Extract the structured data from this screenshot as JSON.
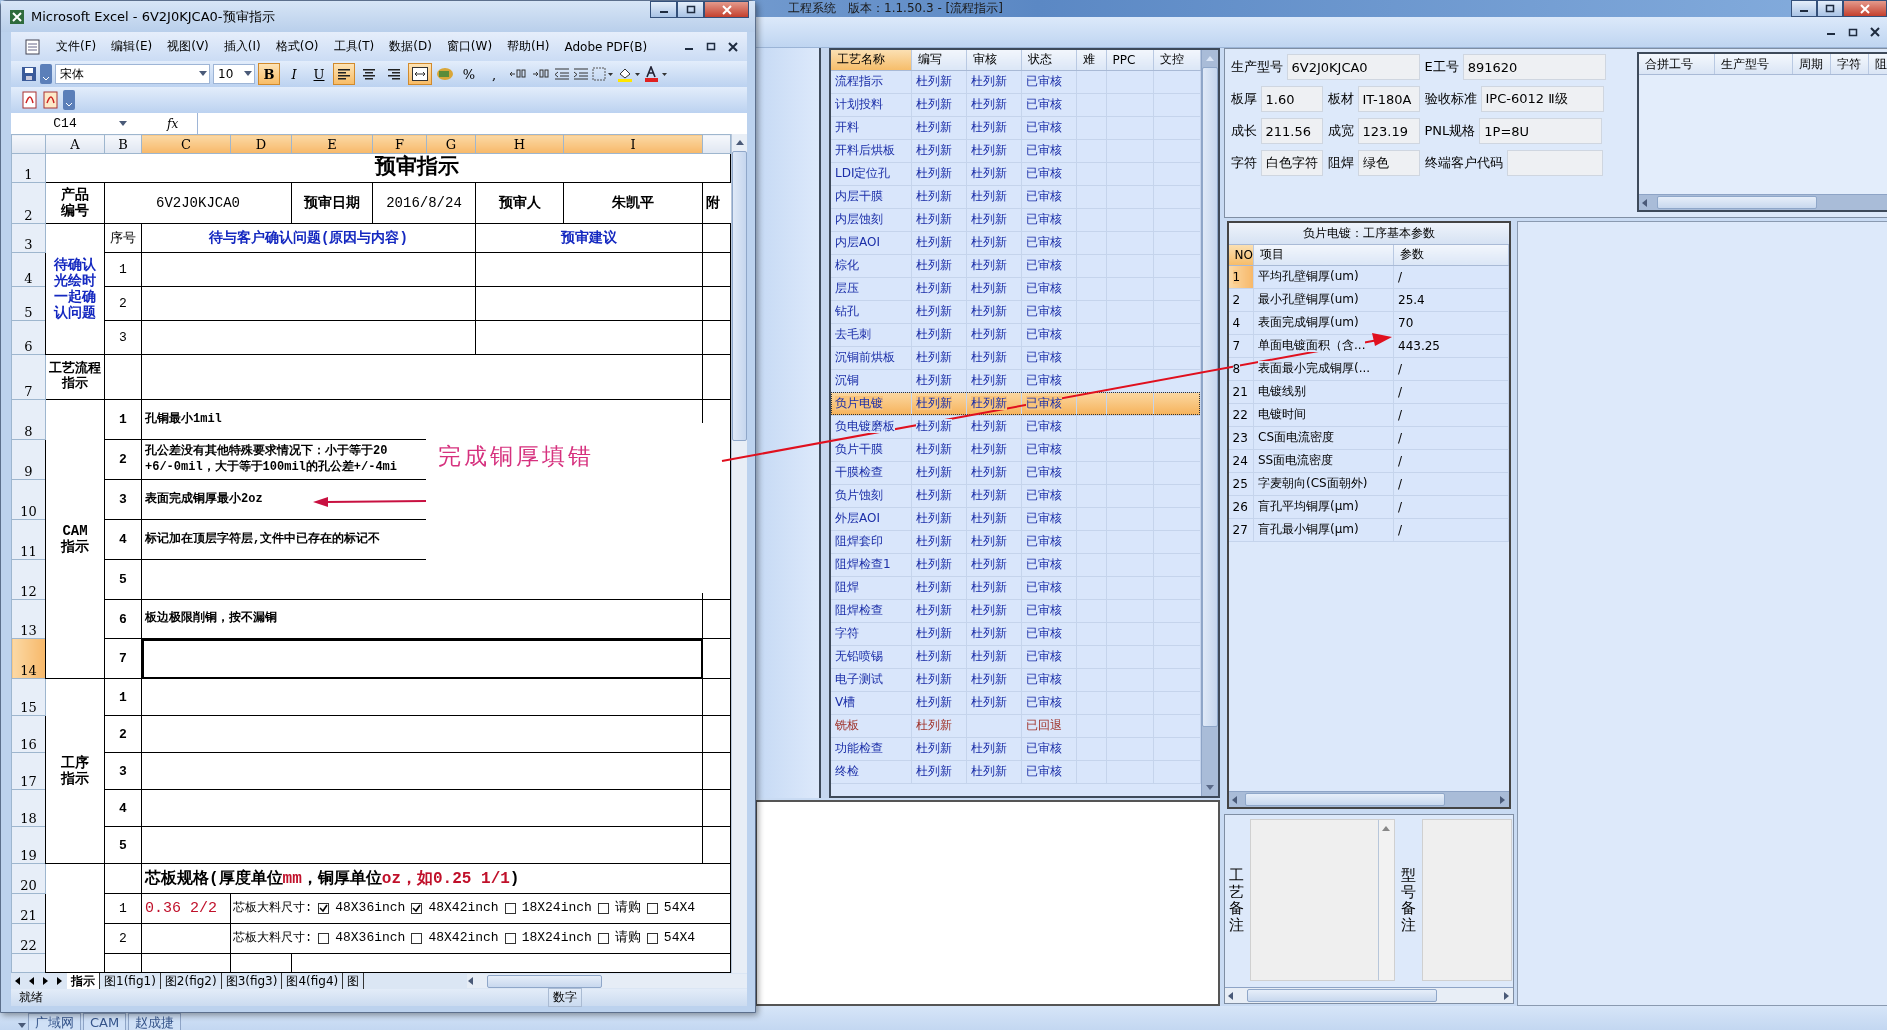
{
  "app": {
    "title": "工程系统　版本：1.1.50.3 - [流程指示]",
    "taskbar": [
      "广域网",
      "CAM",
      "赵成捷"
    ]
  },
  "excel": {
    "title": "Microsoft Excel - 6V2J0KJCA0-预审指示",
    "menu": [
      "文件(F)",
      "编辑(E)",
      "视图(V)",
      "插入(I)",
      "格式(O)",
      "工具(T)",
      "数据(D)",
      "窗口(W)",
      "帮助(H)",
      "Adobe PDF(B)"
    ],
    "font_name": "宋体",
    "font_size": "10",
    "format_buttons": [
      {
        "kind": "bold",
        "label": "B",
        "selected": true
      },
      {
        "kind": "italic",
        "label": "I",
        "selected": false
      },
      {
        "kind": "underline",
        "label": "U",
        "selected": false
      }
    ],
    "align_buttons": [
      {
        "kind": "left",
        "selected": true
      },
      {
        "kind": "center",
        "selected": false
      },
      {
        "kind": "right",
        "selected": false
      },
      {
        "kind": "merge",
        "selected": true
      }
    ],
    "number_labels": [
      "%",
      ","
    ],
    "name_box": "C14",
    "formula_label": "fx",
    "columns": [
      {
        "label": "A",
        "selected": false
      },
      {
        "label": "B",
        "selected": false
      },
      {
        "label": "C",
        "selected": true
      },
      {
        "label": "D",
        "selected": true
      },
      {
        "label": "E",
        "selected": true
      },
      {
        "label": "F",
        "selected": true
      },
      {
        "label": "G",
        "selected": true
      },
      {
        "label": "H",
        "selected": true
      },
      {
        "label": "I",
        "selected": true
      }
    ],
    "row_numbers": [
      {
        "label": "1",
        "selected": false
      },
      {
        "label": "2",
        "selected": false
      },
      {
        "label": "3",
        "selected": false
      },
      {
        "label": "4",
        "selected": false
      },
      {
        "label": "5",
        "selected": false
      },
      {
        "label": "6",
        "selected": false
      },
      {
        "label": "7",
        "selected": false
      },
      {
        "label": "8",
        "selected": false
      },
      {
        "label": "9",
        "selected": false
      },
      {
        "label": "10",
        "selected": false
      },
      {
        "label": "11",
        "selected": false
      },
      {
        "label": "12",
        "selected": false
      },
      {
        "label": "13",
        "selected": false
      },
      {
        "label": "14",
        "selected": true
      },
      {
        "label": "15",
        "selected": false
      },
      {
        "label": "16",
        "selected": false
      },
      {
        "label": "17",
        "selected": false
      },
      {
        "label": "18",
        "selected": false
      },
      {
        "label": "19",
        "selected": false
      },
      {
        "label": "20",
        "selected": false
      },
      {
        "label": "21",
        "selected": false
      },
      {
        "label": "22",
        "selected": false
      }
    ],
    "sheet": {
      "title": "预审指示",
      "product_label": "产品编号",
      "product_no": "6V2J0KJCA0",
      "date_label": "预审日期",
      "date": "2016/8/24",
      "reviewer_label": "预审人",
      "reviewer": "朱凯平",
      "attachment_label": "附",
      "confirm": {
        "label": "待确认光绘时一起确认问题",
        "no_header": "序号",
        "question_header": "待与客户确认问题(原因与内容)",
        "advice_header": "预审建议",
        "items": [
          "1",
          "2",
          "3"
        ]
      },
      "flow_label": "工艺流程指示",
      "cam": {
        "label": "CAM指示",
        "items": [
          {
            "no": "1",
            "text": "孔铜最小1mil"
          },
          {
            "no": "2",
            "text": "孔公差没有其他特殊要求情况下：小于等于20\n+6/-0mil，大于等于100mil的孔公差+/-4mi"
          },
          {
            "no": "3",
            "text": "表面完成铜厚最小2oz"
          },
          {
            "no": "4",
            "text": "标记加在顶层字符层,文件中已存在的标记不"
          },
          {
            "no": "5"
          },
          {
            "no": "6",
            "text": "板边极限削铜，按不漏铜"
          },
          {
            "no": "7",
            "selected": true
          }
        ]
      },
      "process": {
        "label": "工序指示",
        "items": [
          "1",
          "2",
          "3",
          "4",
          "5"
        ]
      },
      "core": {
        "title": [
          {
            "text": "芯板规格(厚度单位",
            "kind": "plain"
          },
          {
            "text": "mm",
            "kind": "red"
          },
          {
            "text": "，铜厚单位",
            "kind": "plain"
          },
          {
            "text": "oz，如0.25 1/1",
            "kind": "red"
          },
          {
            "text": ")",
            "kind": "plain"
          }
        ],
        "items": [
          {
            "no": "1",
            "spec": "0.36 2/2",
            "size_label": "芯板大料尺寸:",
            "options": [
              {
                "label": "48X36inch",
                "checked": true
              },
              {
                "label": "48X42inch",
                "checked": true
              },
              {
                "label": "18X24inch",
                "checked": false
              },
              {
                "label": "请购",
                "checked": false
              },
              {
                "label": "54X4",
                "checked": false
              }
            ]
          },
          {
            "no": "2",
            "size_label": "芯板大料尺寸:",
            "options": [
              {
                "label": "48X36inch",
                "checked": false
              },
              {
                "label": "48X42inch",
                "checked": false
              },
              {
                "label": "18X24inch",
                "checked": false
              },
              {
                "label": "请购",
                "checked": false
              },
              {
                "label": "54X4",
                "checked": false
              }
            ]
          }
        ]
      }
    },
    "annotation": "完成铜厚填错",
    "sheet_tabs": [
      {
        "label": "指示",
        "selected": true
      },
      {
        "label": "图1(fig1)",
        "selected": false
      },
      {
        "label": "图2(fig2)",
        "selected": false
      },
      {
        "label": "图3(fig3)",
        "selected": false
      },
      {
        "label": "图4(fig4)",
        "selected": false
      },
      {
        "label": "图",
        "selected": false
      }
    ],
    "status": "就绪",
    "status_mode": "数字"
  },
  "process_table": {
    "columns": [
      {
        "label": "工艺名称",
        "selected": true
      },
      {
        "label": "编写",
        "selected": false
      },
      {
        "label": "审核",
        "selected": false
      },
      {
        "label": "状态",
        "selected": false
      },
      {
        "label": "难",
        "selected": false
      },
      {
        "label": "PPC",
        "selected": false
      },
      {
        "label": "文控",
        "selected": false
      }
    ],
    "rows": [
      {
        "name": "流程指示",
        "writer": "杜列新",
        "reviewer": "杜列新",
        "status": "已审核",
        "kind": "approved",
        "selected": false
      },
      {
        "name": "计划投料",
        "writer": "杜列新",
        "reviewer": "杜列新",
        "status": "已审核",
        "kind": "approved",
        "selected": false
      },
      {
        "name": "开料",
        "writer": "杜列新",
        "reviewer": "杜列新",
        "status": "已审核",
        "kind": "approved",
        "selected": false
      },
      {
        "name": "开料后烘板",
        "writer": "杜列新",
        "reviewer": "杜列新",
        "status": "已审核",
        "kind": "approved",
        "selected": false
      },
      {
        "name": "LDI定位孔",
        "writer": "杜列新",
        "reviewer": "杜列新",
        "status": "已审核",
        "kind": "approved",
        "selected": false
      },
      {
        "name": "内层干膜",
        "writer": "杜列新",
        "reviewer": "杜列新",
        "status": "已审核",
        "kind": "approved",
        "selected": false
      },
      {
        "name": "内层蚀刻",
        "writer": "杜列新",
        "reviewer": "杜列新",
        "status": "已审核",
        "kind": "approved",
        "selected": false
      },
      {
        "name": "内层AOI",
        "writer": "杜列新",
        "reviewer": "杜列新",
        "status": "已审核",
        "kind": "approved",
        "selected": false
      },
      {
        "name": "棕化",
        "writer": "杜列新",
        "reviewer": "杜列新",
        "status": "已审核",
        "kind": "approved",
        "selected": false
      },
      {
        "name": "层压",
        "writer": "杜列新",
        "reviewer": "杜列新",
        "status": "已审核",
        "kind": "approved",
        "selected": false
      },
      {
        "name": "钻孔",
        "writer": "杜列新",
        "reviewer": "杜列新",
        "status": "已审核",
        "kind": "approved",
        "selected": false
      },
      {
        "name": "去毛刺",
        "writer": "杜列新",
        "reviewer": "杜列新",
        "status": "已审核",
        "kind": "approved",
        "selected": false
      },
      {
        "name": "沉铜前烘板",
        "writer": "杜列新",
        "reviewer": "杜列新",
        "status": "已审核",
        "kind": "approved",
        "selected": false
      },
      {
        "name": "沉铜",
        "writer": "杜列新",
        "reviewer": "杜列新",
        "status": "已审核",
        "kind": "approved",
        "selected": false
      },
      {
        "name": "负片电镀",
        "writer": "杜列新",
        "reviewer": "杜列新",
        "status": "已审核",
        "kind": "approved",
        "selected": true
      },
      {
        "name": "负电镀磨板",
        "writer": "杜列新",
        "reviewer": "杜列新",
        "status": "已审核",
        "kind": "approved",
        "selected": false
      },
      {
        "name": "负片干膜",
        "writer": "杜列新",
        "reviewer": "杜列新",
        "status": "已审核",
        "kind": "approved",
        "selected": false
      },
      {
        "name": "干膜检查",
        "writer": "杜列新",
        "reviewer": "杜列新",
        "status": "已审核",
        "kind": "approved",
        "selected": false
      },
      {
        "name": "负片蚀刻",
        "writer": "杜列新",
        "reviewer": "杜列新",
        "status": "已审核",
        "kind": "approved",
        "selected": false
      },
      {
        "name": "外层AOI",
        "writer": "杜列新",
        "reviewer": "杜列新",
        "status": "已审核",
        "kind": "approved",
        "selected": false
      },
      {
        "name": "阻焊套印",
        "writer": "杜列新",
        "reviewer": "杜列新",
        "status": "已审核",
        "kind": "approved",
        "selected": false
      },
      {
        "name": "阻焊检查1",
        "writer": "杜列新",
        "reviewer": "杜列新",
        "status": "已审核",
        "kind": "approved",
        "selected": false
      },
      {
        "name": "阻焊",
        "writer": "杜列新",
        "reviewer": "杜列新",
        "status": "已审核",
        "kind": "approved",
        "selected": false
      },
      {
        "name": "阻焊检查",
        "writer": "杜列新",
        "reviewer": "杜列新",
        "status": "已审核",
        "kind": "approved",
        "selected": false
      },
      {
        "name": "字符",
        "writer": "杜列新",
        "reviewer": "杜列新",
        "status": "已审核",
        "kind": "approved",
        "selected": false
      },
      {
        "name": "无铅喷锡",
        "writer": "杜列新",
        "reviewer": "杜列新",
        "status": "已审核",
        "kind": "approved",
        "selected": false
      },
      {
        "name": "电子测试",
        "writer": "杜列新",
        "reviewer": "杜列新",
        "status": "已审核",
        "kind": "approved",
        "selected": false
      },
      {
        "name": "V槽",
        "writer": "杜列新",
        "reviewer": "杜列新",
        "status": "已审核",
        "kind": "approved",
        "selected": false
      },
      {
        "name": "铣板",
        "writer": "杜列新",
        "status": "已回退",
        "kind": "returned",
        "selected": false
      },
      {
        "name": "功能检查",
        "writer": "杜列新",
        "reviewer": "杜列新",
        "status": "已审核",
        "kind": "approved",
        "selected": false
      },
      {
        "name": "终检",
        "writer": "杜列新",
        "reviewer": "杜列新",
        "status": "已审核",
        "kind": "approved",
        "selected": false
      }
    ]
  },
  "job_info": {
    "fields": [
      {
        "label": "生产型号",
        "value": "6V2J0KJCA0"
      },
      {
        "label": "E工号",
        "value": "891620"
      },
      {
        "label": "板厚",
        "value": "1.60"
      },
      {
        "label": "板材",
        "value": "IT-180A"
      },
      {
        "label": "验收标准",
        "value": "IPC-6012 Ⅱ级"
      },
      {
        "label": "成长",
        "value": "211.56"
      },
      {
        "label": "成宽",
        "value": "123.19"
      },
      {
        "label": "PNL规格",
        "value": "1P=8U"
      },
      {
        "label": "字符",
        "value": "白色字符"
      },
      {
        "label": "阻焊",
        "value": "绿色"
      },
      {
        "label": "终端客户代码"
      }
    ]
  },
  "merge_table": {
    "columns": [
      "合拼工号",
      "生产型号",
      "周期",
      "字符",
      "阻"
    ]
  },
  "params": {
    "title": "负片电镀：工序基本参数",
    "columns": [
      "NO",
      "项目",
      "参数"
    ],
    "rows": [
      {
        "no": "1",
        "item": "平均孔壁铜厚(um)",
        "value": "/",
        "selected": true
      },
      {
        "no": "2",
        "item": "最小孔壁铜厚(um)",
        "value": "25.4",
        "selected": false
      },
      {
        "no": "4",
        "item": "表面完成铜厚(um)",
        "value": "70",
        "selected": false
      },
      {
        "no": "7",
        "item": "单面电镀面积（含...",
        "value": "443.25",
        "selected": false
      },
      {
        "no": "8",
        "item": "表面最小完成铜厚(...",
        "value": "/",
        "selected": false
      },
      {
        "no": "21",
        "item": "电镀线别",
        "value": "/",
        "selected": false
      },
      {
        "no": "22",
        "item": "电镀时间",
        "value": "/",
        "selected": false
      },
      {
        "no": "23",
        "item": "CS面电流密度",
        "value": "/",
        "selected": false
      },
      {
        "no": "24",
        "item": "SS面电流密度",
        "value": "/",
        "selected": false
      },
      {
        "no": "25",
        "item": "字麦朝向(CS面朝外)",
        "value": "/",
        "selected": false
      },
      {
        "no": "26",
        "item": "盲孔平均铜厚(μm)",
        "value": "/",
        "selected": false
      },
      {
        "no": "27",
        "item": "盲孔最小铜厚(μm)",
        "value": "/",
        "selected": false
      }
    ]
  },
  "remarks": [
    "工艺备注",
    "型号备注"
  ]
}
